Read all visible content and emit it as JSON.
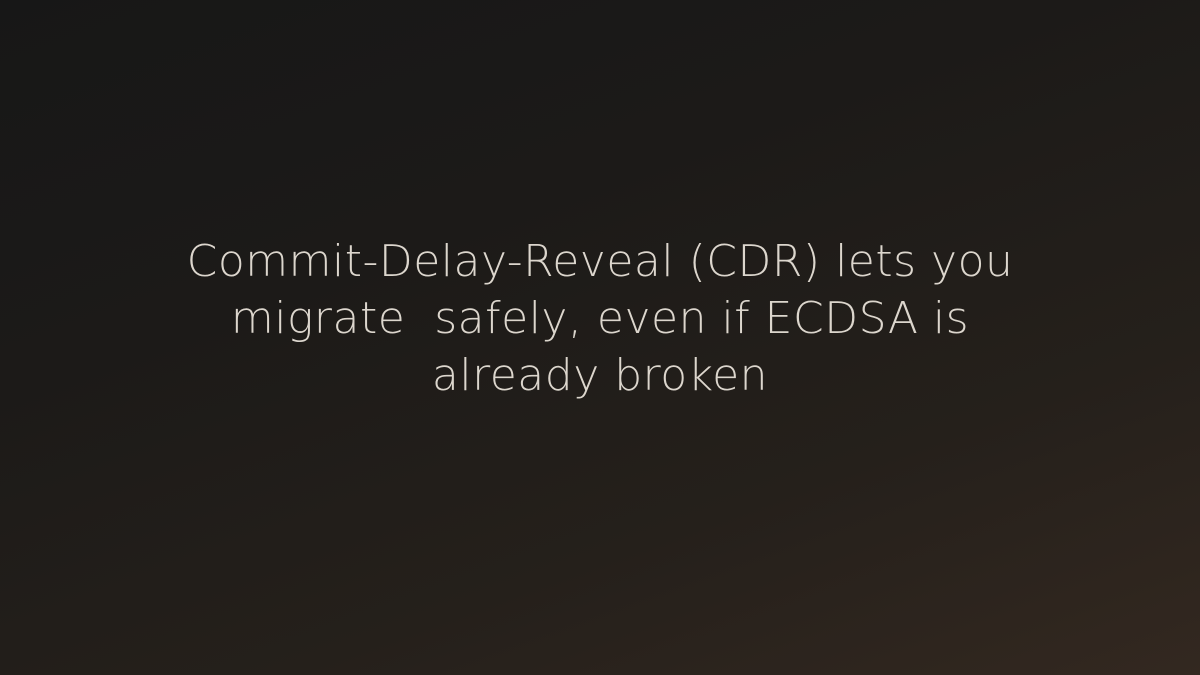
{
  "slide": {
    "lines": [
      "Commit-Delay-Reveal (CDR) lets you",
      "migrate  safely, even if ECDSA is",
      "already broken"
    ]
  },
  "colors": {
    "background_start": "#171717",
    "background_end": "#332820",
    "text": "#dcd6cd"
  }
}
